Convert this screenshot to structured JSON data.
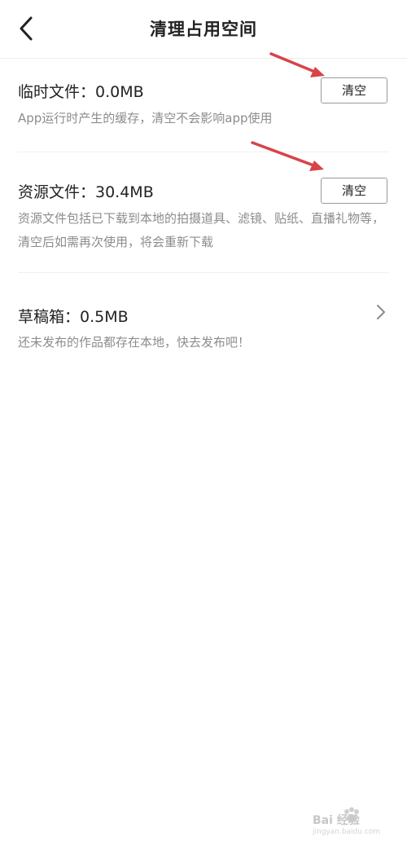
{
  "header": {
    "title": "清理占用空间",
    "back_icon": "chevron-left-icon"
  },
  "items": [
    {
      "title": "临时文件：0.0MB",
      "description": "App运行时产生的缓存，清空不会影响app使用",
      "action_label": "清空"
    },
    {
      "title": "资源文件：30.4MB",
      "description": "资源文件包括已下载到本地的拍摄道具、滤镜、贴纸、直播礼物等，清空后如需再次使用，将会重新下载",
      "action_label": "清空"
    },
    {
      "title": "草稿箱：0.5MB",
      "description": "还未发布的作品都存在本地，快去发布吧！",
      "action_icon": "chevron-right-icon"
    }
  ],
  "annotations": {
    "arrow_color": "#d9434a"
  },
  "watermark": {
    "brand": "Bai 经验",
    "url": "jingyan.baidu.com"
  },
  "colors": {
    "title_text": "#222222",
    "secondary_text": "#8c8c8c",
    "button_border": "#9a9a9a"
  }
}
